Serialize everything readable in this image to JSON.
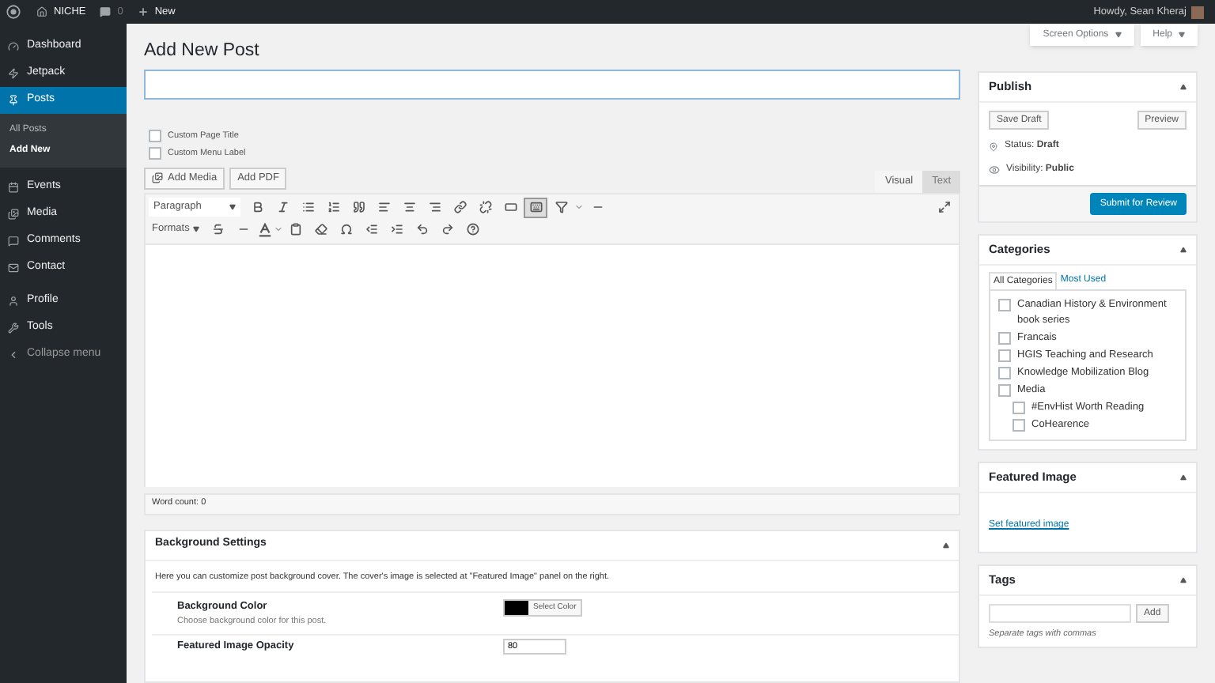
{
  "admin_bar": {
    "site_name": "NICHE",
    "comments_count": "0",
    "new_label": "New",
    "greeting": "Howdy, Sean Kheraj"
  },
  "sidebar": {
    "items": [
      {
        "label": "Dashboard",
        "selected": false
      },
      {
        "label": "Jetpack",
        "selected": false
      },
      {
        "label": "Posts",
        "selected": true,
        "children": [
          {
            "label": "All Posts",
            "selected": false
          },
          {
            "label": "Add New",
            "selected": true
          }
        ]
      },
      {
        "label": "Events",
        "selected": false
      },
      {
        "label": "Media",
        "selected": false
      },
      {
        "label": "Comments",
        "selected": false
      },
      {
        "label": "Contact",
        "selected": false
      },
      {
        "label": "Profile",
        "selected": false
      },
      {
        "label": "Tools",
        "selected": false
      },
      {
        "label": "Collapse menu",
        "selected": false
      }
    ]
  },
  "screen_buttons": [
    "Screen Options",
    "Help"
  ],
  "page_title": "Add New Post",
  "options": [
    {
      "label": "Custom Page Title",
      "checked": false
    },
    {
      "label": "Custom Menu Label",
      "checked": false
    }
  ],
  "media_buttons": [
    "Add Media",
    "Add PDF"
  ],
  "editor_tabs": [
    {
      "label": "Visual",
      "selected": true
    },
    {
      "label": "Text",
      "selected": false
    }
  ],
  "toolbar": {
    "format_select": "Paragraph",
    "formats_menu": "Formats",
    "toggle_pressed": true
  },
  "word_count": "Word count: 0",
  "background_settings": {
    "title": "Background Settings",
    "description": "Here you can customize post background cover. The cover's image is selected at \"Featured Image\" panel on the right.",
    "color": {
      "label": "Background Color",
      "hint": "Choose background color for this post.",
      "button": "Select Color"
    },
    "opacity": {
      "label": "Featured Image Opacity",
      "value": "80"
    }
  },
  "publish": {
    "title": "Publish",
    "save_draft": "Save Draft",
    "preview": "Preview",
    "status_label": "Status:",
    "status": "Draft",
    "visibility_label": "Visibility:",
    "visibility": "Public",
    "submit": "Submit for Review"
  },
  "categories": {
    "title": "Categories",
    "tabs": [
      {
        "label": "All Categories",
        "selected": true
      },
      {
        "label": "Most Used",
        "selected": false
      }
    ],
    "items": [
      {
        "label": "Canadian History & Environment book series",
        "checked": false
      },
      {
        "label": "Francais",
        "checked": false
      },
      {
        "label": "HGIS Teaching and Research",
        "checked": false
      },
      {
        "label": "Knowledge Mobilization Blog",
        "checked": false
      },
      {
        "label": "Media",
        "checked": false,
        "children": [
          {
            "label": "#EnvHist Worth Reading",
            "checked": false
          },
          {
            "label": "CoHearence",
            "checked": false
          }
        ]
      }
    ]
  },
  "featured_image": {
    "title": "Featured Image",
    "link": "Set featured image"
  },
  "tags": {
    "title": "Tags",
    "button": "Add",
    "hint": "Separate tags with commas"
  }
}
